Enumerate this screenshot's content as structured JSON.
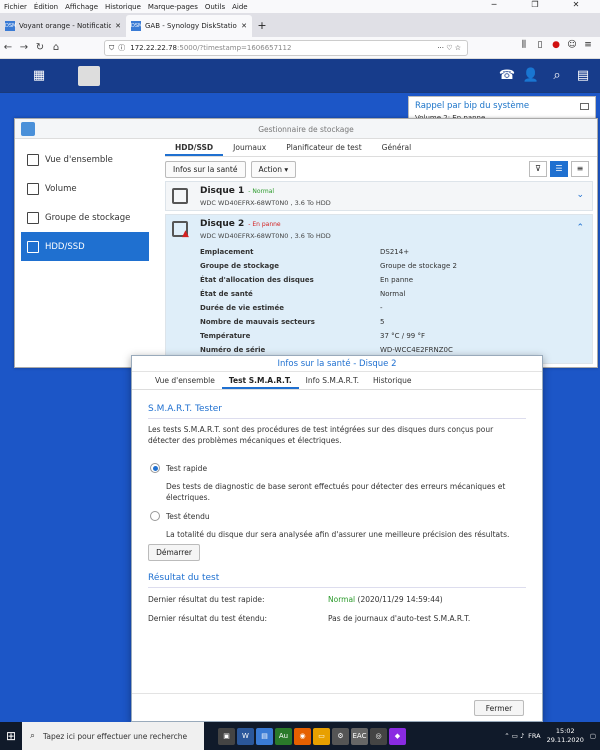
{
  "browser": {
    "menu": [
      "Fichier",
      "Édition",
      "Affichage",
      "Historique",
      "Marque-pages",
      "Outils",
      "Aide"
    ],
    "tabs": [
      {
        "favicon": "DSM",
        "title": "Voyant orange - Notification ...",
        "active": false
      },
      {
        "favicon": "DSM",
        "title": "GAB - Synology DiskStation",
        "active": true
      }
    ],
    "url": {
      "host": "172.22.22.78",
      "rest": ":5000/?timestamp=1606657112"
    }
  },
  "notification": {
    "title": "Rappel par bip du système",
    "text": "Volume 2: En panne"
  },
  "storage_manager": {
    "title": "Gestionnaire de stockage",
    "sidebar": [
      {
        "label": "Vue d'ensemble",
        "icon": "overview-icon",
        "active": false
      },
      {
        "label": "Volume",
        "icon": "volume-icon",
        "active": false
      },
      {
        "label": "Groupe de stockage",
        "icon": "storage-pool-icon",
        "active": false
      },
      {
        "label": "HDD/SSD",
        "icon": "hdd-icon",
        "active": true
      }
    ],
    "tabs": [
      "HDD/SSD",
      "Journaux",
      "Planificateur de test",
      "Général"
    ],
    "toolbar": {
      "health": "Infos sur la santé",
      "action": "Action ▾"
    },
    "disks": [
      {
        "name": "Disque 1",
        "status": "- Normal",
        "model": "WDC WD40EFRX-68WT0N0 , 3.6 To HDD"
      },
      {
        "name": "Disque 2",
        "status": "- En panne",
        "model": "WDC WD40EFRX-68WT0N0 , 3.6 To HDD"
      }
    ],
    "props": [
      {
        "k": "Emplacement",
        "v": "DS214+"
      },
      {
        "k": "Groupe de stockage",
        "v": "Groupe de stockage 2"
      },
      {
        "k": "État d'allocation des disques",
        "v": "En panne"
      },
      {
        "k": "État de santé",
        "v": "Normal"
      },
      {
        "k": "Durée de vie estimée",
        "v": "-"
      },
      {
        "k": "Nombre de mauvais secteurs",
        "v": "5"
      },
      {
        "k": "Température",
        "v": "37 °C / 99 °F"
      },
      {
        "k": "Numéro de série",
        "v": "WD-WCC4E2FRNZ0C"
      }
    ]
  },
  "modal": {
    "title": "Infos sur la santé - Disque 2",
    "tabs": [
      "Vue d'ensemble",
      "Test S.M.A.R.T.",
      "Info S.M.A.R.T.",
      "Historique"
    ],
    "section1": "S.M.A.R.T. Tester",
    "intro": "Les tests S.M.A.R.T. sont des procédures de test intégrées sur des disques durs conçus pour détecter des problèmes mécaniques et électriques.",
    "quick_label": "Test rapide",
    "quick_desc": "Des tests de diagnostic de base seront effectués pour détecter des erreurs mécaniques et électriques.",
    "ext_label": "Test étendu",
    "ext_desc": "La totalité du disque dur sera analysée afin d'assurer une meilleure précision des résultats.",
    "start": "Démarrer",
    "section2": "Résultat du test",
    "last_quick_label": "Dernier résultat du test rapide:",
    "last_quick_status": "Normal",
    "last_quick_date": "(2020/11/29 14:59:44)",
    "last_ext_label": "Dernier résultat du test étendu:",
    "last_ext_value": "Pas de journaux d'auto-test S.M.A.R.T.",
    "close": "Fermer"
  },
  "taskbar": {
    "search": "Tapez ici pour effectuer une recherche",
    "lang": "FRA",
    "time": "15:02",
    "date": "29.11.2020"
  }
}
